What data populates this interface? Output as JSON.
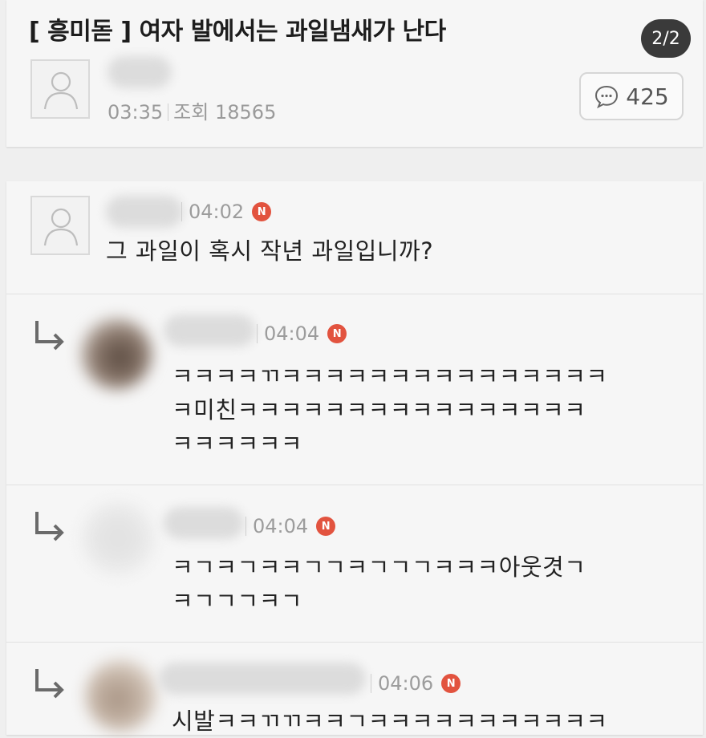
{
  "post": {
    "title": "[ 흥미돋 ] 여자 발에서는 과일냄새가 난다",
    "page_indicator": "2/2",
    "time": "03:35",
    "views_label": "조회",
    "views": "18565",
    "comment_count": "425"
  },
  "comments": [
    {
      "time": "04:02",
      "badge": "N",
      "lines": [
        "그 과일이 혹시 작년 과일입니까?"
      ]
    },
    {
      "time": "04:04",
      "badge": "N",
      "lines": [
        "ㅋㅋㅋㅋㄲㅋㅋㅋㅋㅋㅋㅋㅋㅋㅋㅋㅋㅋㅋㅋ",
        "ㅋ미친ㅋㅋㅋㅋㅋㅋㅋㅋㅋㅋㅋㅋㅋㅋㅋㅋ",
        "ㅋㅋㅋㅋㅋㅋ"
      ]
    },
    {
      "time": "04:04",
      "badge": "N",
      "lines": [
        "ㅋㄱㅋㄱㅋㅋㄱㄱㅋㄱㄱㄱㅋㅋㅋ아웃겻ㄱ",
        "ㅋㄱㄱㄱㅋㄱ"
      ]
    },
    {
      "time": "04:06",
      "badge": "N",
      "lines": [
        "시발ㅋㅋㄲㄲㅋㅋㄱㅋㅋㅋㅋㅋㅋㅋㅋㅋㅋㅋ"
      ]
    }
  ],
  "colors": {
    "new_badge": "#e2533f",
    "page_badge_bg": "#3a3a3a"
  },
  "icons": [
    "user-avatar-icon",
    "speech-bubble-icon",
    "reply-arrow-icon",
    "new-badge-icon"
  ]
}
